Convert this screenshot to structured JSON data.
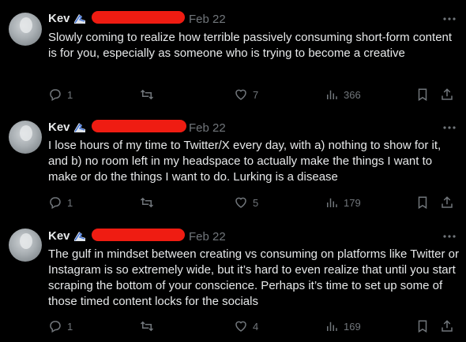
{
  "tweets": [
    {
      "name": "Kev",
      "time": "Feb 22",
      "text": "Slowly coming to realize how terrible passively consuming short-form content is for you, especially as someone who is trying to become a creative",
      "replies": "1",
      "retweets": "",
      "likes": "7",
      "views": "366"
    },
    {
      "name": "Kev",
      "time": "Feb 22",
      "text": "I lose hours of my time to Twitter/X every day, with a) nothing to show for it, and b) no room left in my headspace to actually make the things I want to make or do the things I want to do. Lurking is a disease",
      "replies": "1",
      "retweets": "",
      "likes": "5",
      "views": "179"
    },
    {
      "name": "Kev",
      "time": "Feb 22",
      "text": "The gulf in mindset between creating vs consuming on platforms like Twitter or Instagram is so extremely wide, but it’s hard to even realize that until you start scraping the bottom of your conscience. Perhaps it’s time to set up some of those timed content locks for the socials",
      "replies": "1",
      "retweets": "",
      "likes": "4",
      "views": "169"
    }
  ],
  "colors": {
    "text": "#e7e9ea",
    "muted": "#71767b",
    "redaction": "#ef1c12",
    "background": "#000000"
  },
  "icons": [
    "reply-icon",
    "retweet-icon",
    "like-icon",
    "views-icon",
    "bookmark-icon",
    "share-icon",
    "more-icon"
  ]
}
